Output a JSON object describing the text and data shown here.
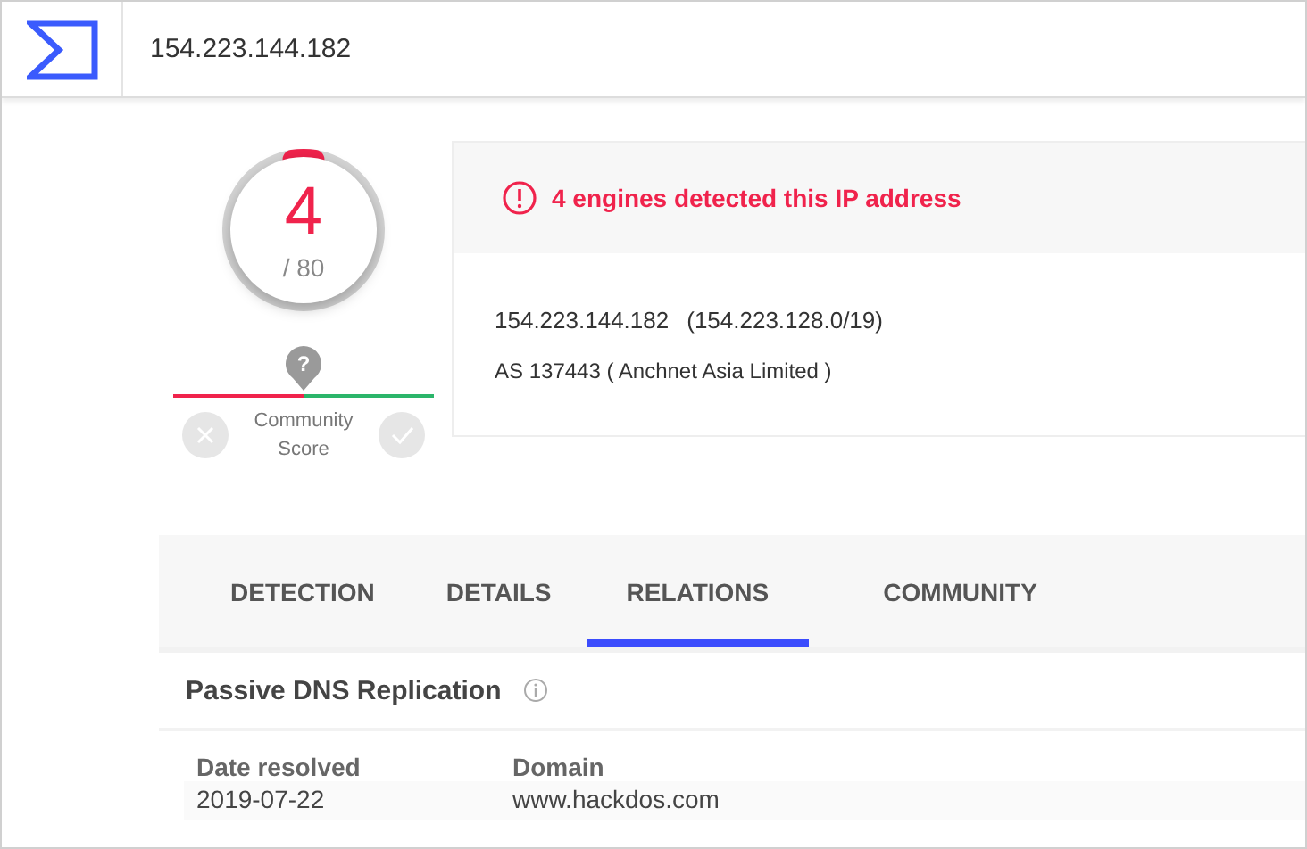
{
  "search": {
    "value": "154.223.144.182"
  },
  "score": {
    "detections": "4",
    "total": "/ 80",
    "level": 0.05
  },
  "community": {
    "label": "Community Score",
    "marker": "?"
  },
  "alert": {
    "text": "4 engines detected this IP address"
  },
  "ip_info": {
    "address": "154.223.144.182",
    "network": "(154.223.128.0/19)",
    "as_line": "AS 137443 ( Anchnet Asia Limited )"
  },
  "tabs": [
    {
      "label": "DETECTION",
      "selected": false
    },
    {
      "label": "DETAILS",
      "selected": false
    },
    {
      "label": "RELATIONS",
      "selected": true
    },
    {
      "label": "COMMUNITY",
      "selected": false
    }
  ],
  "section": {
    "title": "Passive DNS Replication"
  },
  "table": {
    "columns": [
      "Date resolved",
      "Domain"
    ],
    "rows": [
      [
        "2019-07-22",
        "www.hackdos.com"
      ]
    ]
  }
}
